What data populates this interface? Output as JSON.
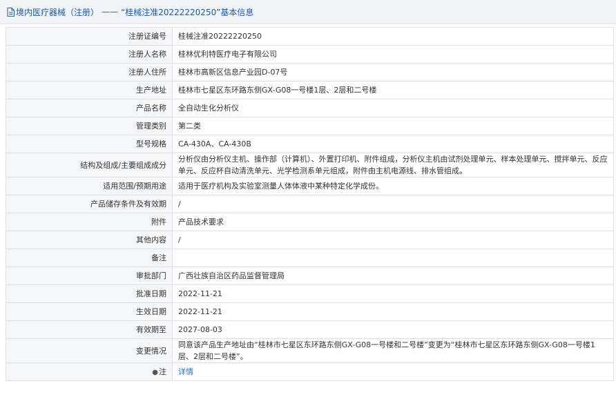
{
  "header": {
    "breadcrumb_root": "境内医疗器械（注册）",
    "separator": "——",
    "title": "“桂械注准20222220250”基本信息"
  },
  "rows": [
    {
      "label": "注册证编号",
      "value": "桂械注准20222220250"
    },
    {
      "label": "注册人名称",
      "value": "桂林优利特医疗电子有限公司"
    },
    {
      "label": "注册人住所",
      "value": "桂林市高新区信息产业园D-07号"
    },
    {
      "label": "生产地址",
      "value": "桂林市七星区东环路东侧GX-G08一号楼1层、2层和二号楼"
    },
    {
      "label": "产品名称",
      "value": "全自动生化分析仪"
    },
    {
      "label": "管理类别",
      "value": "第二类"
    },
    {
      "label": "型号规格",
      "value": "CA-430A、CA-430B"
    },
    {
      "label": "结构及组成/主要组成成分",
      "value": "分析仪由分析仪主机、操作部（计算机）、外置打印机、附件组成，分析仪主机由试剂处理单元、样本处理单元、搅拌单元、反应单元、反应杯自动清洗单元、光学检测系单元组成，附件由主机电源线、排水管组成。"
    },
    {
      "label": "适用范围/预期用途",
      "value": "适用于医疗机构及实验室测量人体体液中某种特定化学成份。"
    },
    {
      "label": "产品储存条件及有效期",
      "value": "/"
    },
    {
      "label": "附件",
      "value": "产品技术要求"
    },
    {
      "label": "其他内容",
      "value": "/"
    },
    {
      "label": "备注",
      "value": ""
    },
    {
      "label": "审批部门",
      "value": "广西壮族自治区药品监督管理局"
    },
    {
      "label": "批准日期",
      "value": "2022-11-21"
    },
    {
      "label": "生效日期",
      "value": "2022-11-21"
    },
    {
      "label": "有效期至",
      "value": "2027-08-03"
    },
    {
      "label": "变更情况",
      "value": "同意该产品生产地址由“桂林市七星区东环路东侧GX-G08一号楼和二号楼”变更为“桂林市七星区东环路东侧GX-G08一号楼1层、2层和二号楼”。"
    }
  ],
  "note": {
    "label": "注",
    "link": "详情",
    "icon": "pin-icon"
  }
}
